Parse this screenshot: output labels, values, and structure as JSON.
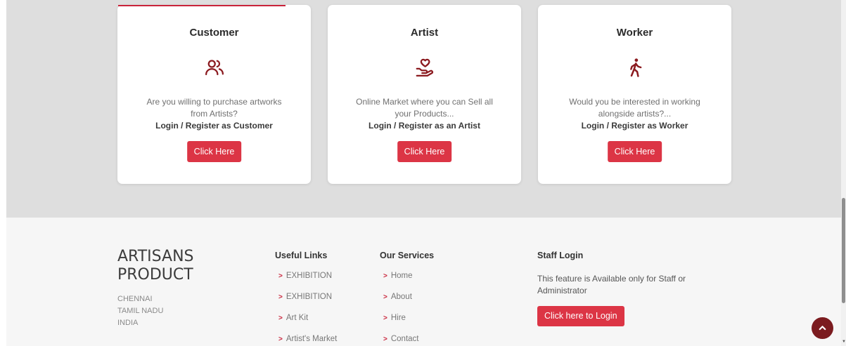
{
  "cards": [
    {
      "title": "Customer",
      "icon": "users-icon",
      "description": "Are you willing to purchase artworks from Artists?",
      "cta": "Login / Register as Customer",
      "button": "Click Here"
    },
    {
      "title": "Artist",
      "icon": "hand-heart-icon",
      "description": "Online Market where you can Sell all your Products...",
      "cta": "Login / Register as an Artist",
      "button": "Click Here"
    },
    {
      "title": "Worker",
      "icon": "walking-person-icon",
      "description": "Would you be interested in working alongside artists?...",
      "cta": "Login / Register as Worker",
      "button": "Click Here"
    }
  ],
  "footer": {
    "brand_line1": "ARTISANS",
    "brand_line2": "PRODUCT",
    "address": [
      "CHENNAI",
      "TAMIL NADU",
      "INDIA"
    ],
    "useful_links": {
      "title": "Useful Links",
      "items": [
        "EXHIBITION",
        "EXHIBITION",
        "Art Kit",
        "Artist's Market"
      ]
    },
    "services": {
      "title": "Our Services",
      "items": [
        "Home",
        "About",
        "Hire",
        "Contact"
      ]
    },
    "staff": {
      "title": "Staff Login",
      "description": "This feature is Available only for Staff or Administrator",
      "button": "Click here to Login"
    }
  },
  "colors": {
    "accent": "#dc3545",
    "icon": "#8b1a1f",
    "back_to_top": "#7b1b1f"
  },
  "back_to_top_icon": "chevron-up-icon"
}
